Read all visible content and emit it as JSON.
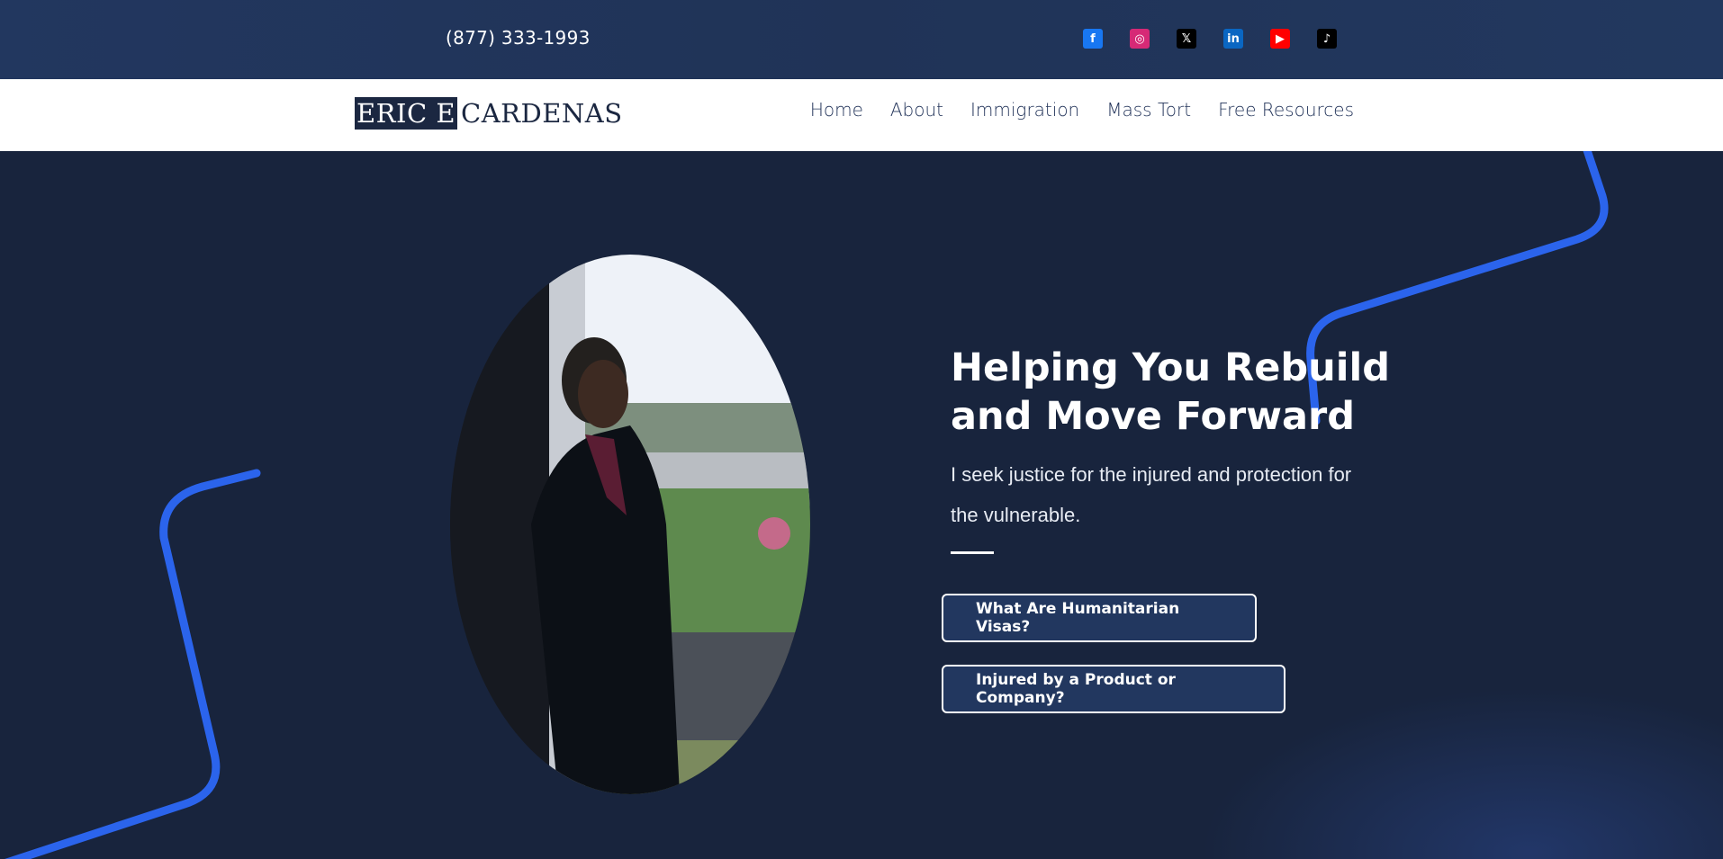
{
  "topbar": {
    "phone": "(877) 333-1993",
    "social_icons": [
      {
        "name": "facebook-icon",
        "glyph": "f",
        "color": "#1877f2"
      },
      {
        "name": "instagram-icon",
        "glyph": "◎",
        "color": "#d62976"
      },
      {
        "name": "x-icon",
        "glyph": "𝕏",
        "color": "#000000"
      },
      {
        "name": "linkedin-icon",
        "glyph": "in",
        "color": "#0a66c2"
      },
      {
        "name": "youtube-icon",
        "glyph": "▶",
        "color": "#ff0000"
      },
      {
        "name": "tiktok-icon",
        "glyph": "♪",
        "color": "#000000"
      }
    ]
  },
  "header": {
    "logo_first": "ERIC E",
    "logo_last": "CARDENAS",
    "nav": [
      "Home",
      "About",
      "Immigration",
      "Mass Tort",
      "Free Resources"
    ]
  },
  "hero": {
    "headline": "Helping You Rebuild and Move Forward",
    "subhead": "I seek justice for the injured and protection for the vulnerable.",
    "cta_primary": "What Are Humanitarian Visas?",
    "cta_secondary": "Injured by a Product or Company?"
  },
  "colors": {
    "topbar": "#22375f",
    "hero_bg": "#18243d",
    "accent_line": "#2d6bff",
    "nav_text": "#23345a",
    "button_bg": "#22375f"
  }
}
